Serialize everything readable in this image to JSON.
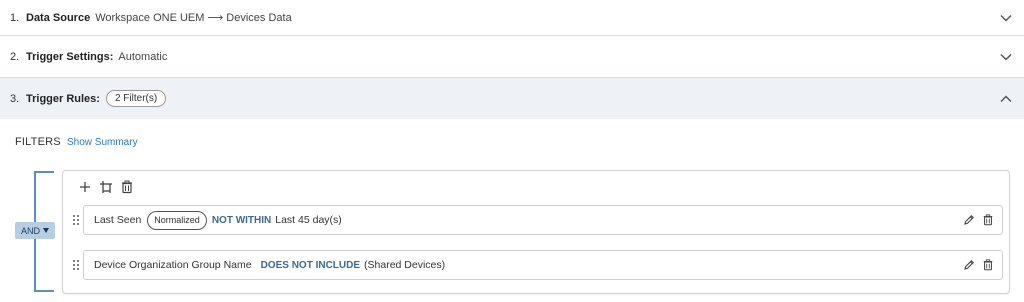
{
  "steps": [
    {
      "number": "1.",
      "title": "Data Source",
      "value": "Workspace ONE UEM ⟶ Devices Data"
    },
    {
      "number": "2.",
      "title": "Trigger Settings:",
      "value": "Automatic"
    },
    {
      "number": "3.",
      "title": "Trigger Rules:",
      "badge": "2 Filter(s)"
    }
  ],
  "filters": {
    "heading": "FILTERS",
    "show_summary": "Show Summary",
    "logic_operator": "AND",
    "rules": [
      {
        "field": "Last Seen",
        "tag": "Normalized",
        "operator": "NOT WITHIN",
        "value": "Last 45 day(s)"
      },
      {
        "field": "Device Organization Group Name",
        "operator": "DOES NOT INCLUDE",
        "value": "(Shared Devices)"
      }
    ]
  },
  "colors": {
    "accent_link": "#2f78b8",
    "operator_text": "#3d6a93",
    "bracket": "#5b8ec7",
    "and_button_bg": "#b6cde3",
    "active_row_bg": "#eef2f6"
  }
}
